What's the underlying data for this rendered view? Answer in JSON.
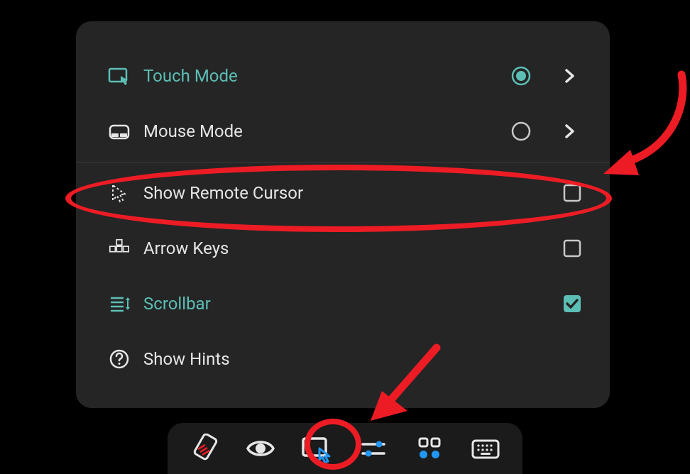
{
  "menu": {
    "items": [
      {
        "id": "touch-mode",
        "label": "Touch Mode",
        "active": true,
        "control": "radio-on",
        "chevron": true
      },
      {
        "id": "mouse-mode",
        "label": "Mouse Mode",
        "active": false,
        "control": "radio-off",
        "chevron": true
      },
      {
        "id": "show-remote-cursor",
        "label": "Show Remote Cursor",
        "active": false,
        "control": "checkbox-off"
      },
      {
        "id": "arrow-keys",
        "label": "Arrow Keys",
        "active": false,
        "control": "checkbox-off"
      },
      {
        "id": "scrollbar",
        "label": "Scrollbar",
        "active": true,
        "control": "checkbox-on"
      },
      {
        "id": "show-hints",
        "label": "Show Hints",
        "active": false,
        "control": "none"
      }
    ]
  },
  "toolbar": {
    "items": [
      {
        "id": "eraser",
        "icon": "eraser-icon"
      },
      {
        "id": "eye",
        "icon": "eye-icon"
      },
      {
        "id": "cursor-panel",
        "icon": "screen-cursor-icon",
        "highlighted": true
      },
      {
        "id": "sliders",
        "icon": "sliders-icon"
      },
      {
        "id": "grid",
        "icon": "grid-icon"
      },
      {
        "id": "keyboard",
        "icon": "keyboard-icon"
      }
    ]
  },
  "colors": {
    "teal": "#5cbfb5",
    "panel": "#252525",
    "toolbar": "#1b1b1b",
    "annotation": "#ed1c24",
    "blueAccent": "#2196f3"
  },
  "annotations": {
    "circledMenuItem": "show-remote-cursor",
    "circledToolbarItem": "cursor-panel",
    "arrows": [
      "top-right-to-cursor-row",
      "bottom-pointing-to-toolbar-cursor"
    ]
  }
}
